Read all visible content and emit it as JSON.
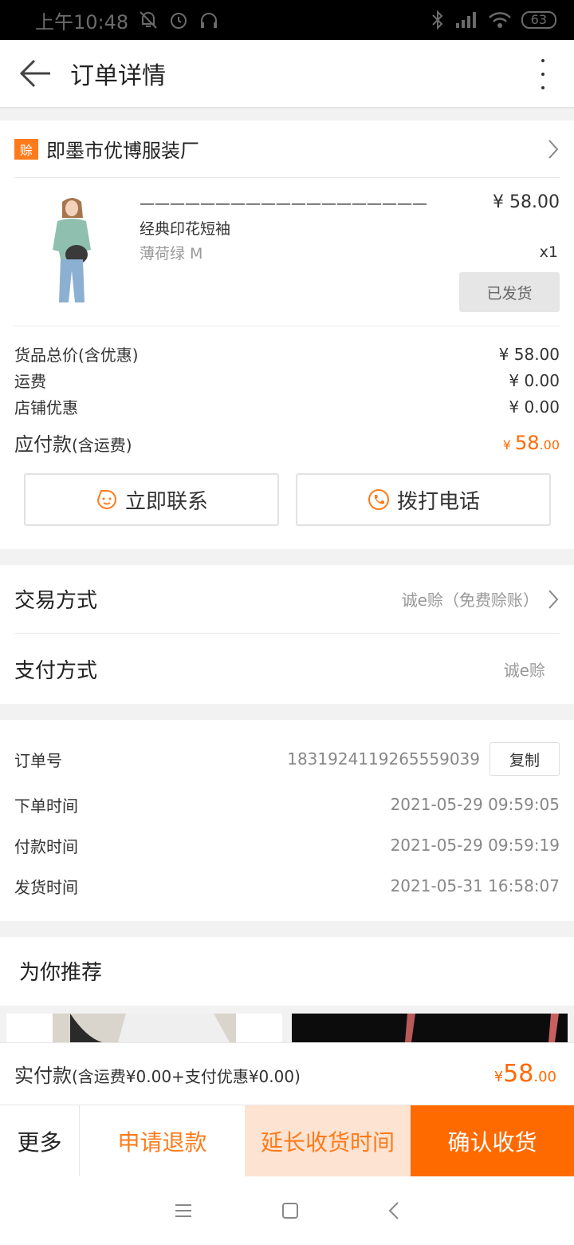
{
  "status_bar": {
    "time": "上午10:48",
    "battery": "63"
  },
  "header": {
    "title": "订单详情"
  },
  "seller": {
    "badge": "赊",
    "name": "即墨市优博服装厂"
  },
  "product": {
    "name": "——————————————————— 经典印花短袖",
    "price": "¥ 58.00",
    "variant": "薄荷绿 M",
    "qty": "x1",
    "status_button": "已发货"
  },
  "costs": {
    "goods_label": "货品总价(含优惠)",
    "goods_value": "¥ 58.00",
    "shipping_label": "运费",
    "shipping_value": "¥ 0.00",
    "discount_label": "店铺优惠",
    "discount_value": "¥ 0.00",
    "due_label": "应付款",
    "due_label_small": "(含运费)",
    "due_currency": "¥ ",
    "due_int": "58",
    "due_dec": ".00"
  },
  "contact": {
    "chat_label": "立即联系",
    "call_label": "拨打电话"
  },
  "trade": {
    "method_label": "交易方式",
    "method_value": "诚e赊（免费赊账）",
    "payment_label": "支付方式",
    "payment_value": "诚e赊"
  },
  "order_info": {
    "order_no_label": "订单号",
    "order_no": "1831924119265559039",
    "copy_label": "复制",
    "placed_label": "下单时间",
    "placed": "2021-05-29 09:59:05",
    "paid_label": "付款时间",
    "paid": "2021-05-29 09:59:19",
    "shipped_label": "发货时间",
    "shipped": "2021-05-31 16:58:07"
  },
  "recommend": {
    "title": "为你推荐"
  },
  "pay_bar": {
    "label": "实付款",
    "label_small": "(含运费¥0.00+支付优惠¥0.00)",
    "currency": "¥",
    "int": "58",
    "dec": ".00"
  },
  "actions": {
    "more": "更多",
    "refund": "申请退款",
    "extend": "延长收货时间",
    "confirm": "确认收货"
  },
  "colors": {
    "accent": "#ff6a00",
    "accent_light": "#fde3d1"
  },
  "icons": [
    "back-arrow-icon",
    "more-vert-icon",
    "chevron-right-icon",
    "chat-face-icon",
    "phone-icon",
    "nav-menu-icon",
    "nav-home-icon",
    "nav-back-icon"
  ]
}
